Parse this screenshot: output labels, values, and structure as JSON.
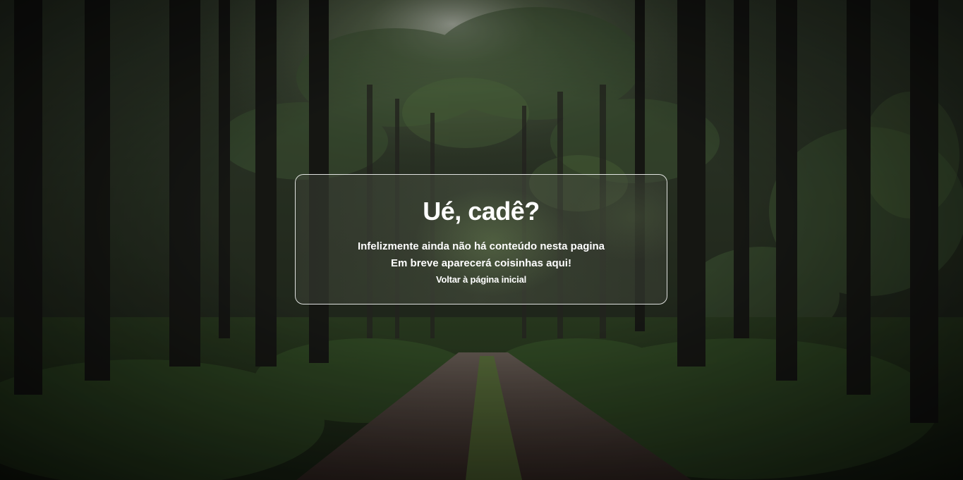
{
  "background": {
    "scene": "forest-path",
    "colors": {
      "dark": "#1c1d1a",
      "foliage": "#3f5a2c",
      "light_canopy": "#c9d3bf",
      "path": "#4a3a33"
    }
  },
  "card": {
    "title": "Ué, cadê?",
    "line1": "Infelizmente ainda não há conteúdo nesta pagina",
    "line2": "Em breve aparecerá coisinhas aqui!",
    "link_label": "Voltar à página inicial"
  }
}
